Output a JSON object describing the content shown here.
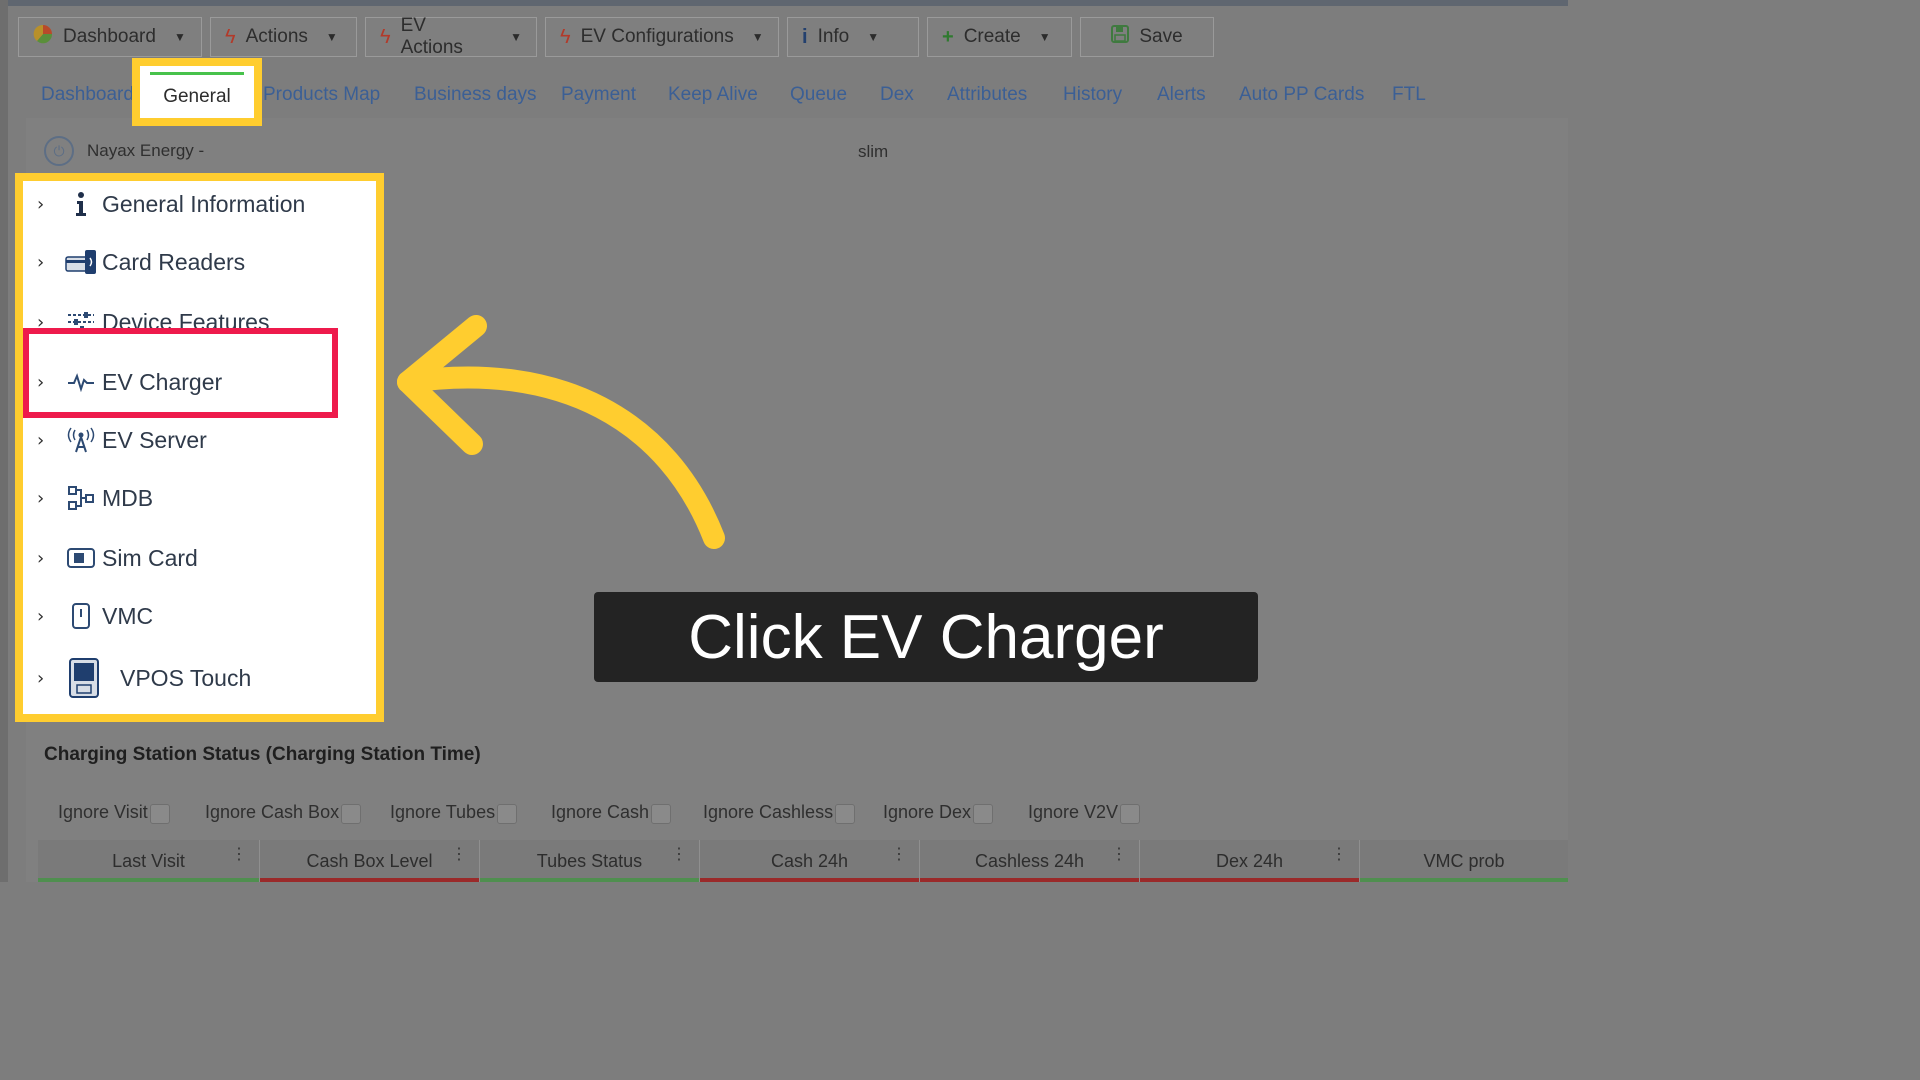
{
  "toolbar": {
    "buttons": [
      {
        "label": "Dashboard",
        "icon": "pie-chart-icon"
      },
      {
        "label": "Actions",
        "icon": "bolt-icon"
      },
      {
        "label": "EV Actions",
        "icon": "bolt-icon"
      },
      {
        "label": "EV Configurations",
        "icon": "bolt-icon"
      },
      {
        "label": "Info",
        "icon": "info-icon"
      },
      {
        "label": "Create",
        "icon": "plus-icon"
      },
      {
        "label": "Save",
        "icon": "floppy-disk-icon"
      }
    ]
  },
  "tabs": {
    "items": [
      "Dashboard",
      "General",
      "Products Map",
      "Business days",
      "Payment",
      "Keep Alive",
      "Queue",
      "Dex",
      "Attributes",
      "History",
      "Alerts",
      "Auto PP Cards",
      "FTL"
    ],
    "active": "General"
  },
  "device": {
    "name": "Nayax Energy -",
    "type": "slim"
  },
  "menu": {
    "items": [
      {
        "label": "General Information",
        "icon": "info-icon"
      },
      {
        "label": "Card Readers",
        "icon": "card-reader-icon"
      },
      {
        "label": "Device Features",
        "icon": "sliders-icon"
      },
      {
        "label": "EV Charger",
        "icon": "pulse-icon"
      },
      {
        "label": "EV Server",
        "icon": "antenna-icon"
      },
      {
        "label": "MDB",
        "icon": "network-icon"
      },
      {
        "label": "Sim Card",
        "icon": "sim-card-icon"
      },
      {
        "label": "VMC",
        "icon": "vmc-icon"
      },
      {
        "label": "VPOS Touch",
        "icon": "pos-terminal-icon"
      }
    ]
  },
  "callout": {
    "text": "Click EV Charger"
  },
  "status_section": {
    "title": "Charging Station Status (Charging Station Time)",
    "checkboxes": [
      "Ignore Visit",
      "Ignore Cash Box",
      "Ignore Tubes",
      "Ignore Cash",
      "Ignore Cashless",
      "Ignore Dex",
      "Ignore V2V"
    ],
    "columns": [
      "Last Visit",
      "Cash Box Level",
      "Tubes Status",
      "Cash 24h",
      "Cashless 24h",
      "Dex 24h",
      "VMC prob"
    ]
  },
  "colors": {
    "highlight_yellow": "#ffcd2f",
    "highlight_red": "#ee1a4c",
    "tab_link": "#3b5f95",
    "active_tab_underline": "#47c24b"
  }
}
